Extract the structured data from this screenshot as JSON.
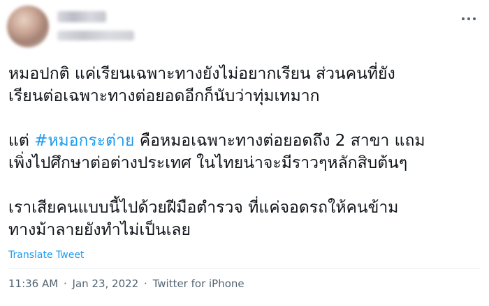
{
  "author": {
    "display_name": "",
    "handle": ""
  },
  "tweet": {
    "para1_line1": "หมอปกติ แค่เรียนเฉพาะทางยังไม่อยากเรียน ส่วนคนที่ยัง",
    "para1_line2": "เรียนต่อเฉพาะทางต่อยอดอีกก็นับว่าทุ่มเทมาก",
    "para2_prefix": "แต่ ",
    "hashtag": "#หมอกระต่าย",
    "para2_line1_rest": " คือหมอเฉพาะทางต่อยอดถึง 2 สาขา แถม",
    "para2_line2": "เพิ่งไปศึกษาต่อต่างประเทศ ในไทยน่าจะมีราวๆหลักสิบต้นๆ",
    "para3_line1": "เราเสียคนแบบนี้ไปด้วยฝีมือตำรวจ ที่แค่จอดรถให้คนข้าม",
    "para3_line2": "ทางม้าลายยังทำไม่เป็นเลย"
  },
  "translate_label": "Translate Tweet",
  "meta": {
    "time": "11:36 AM",
    "separator": "·",
    "date": "Jan 23, 2022",
    "source": "Twitter for iPhone"
  },
  "icons": {
    "more": "more-dots-icon"
  },
  "colors": {
    "link": "#1d9bf0",
    "text": "#0f1419",
    "secondary": "#536471"
  }
}
